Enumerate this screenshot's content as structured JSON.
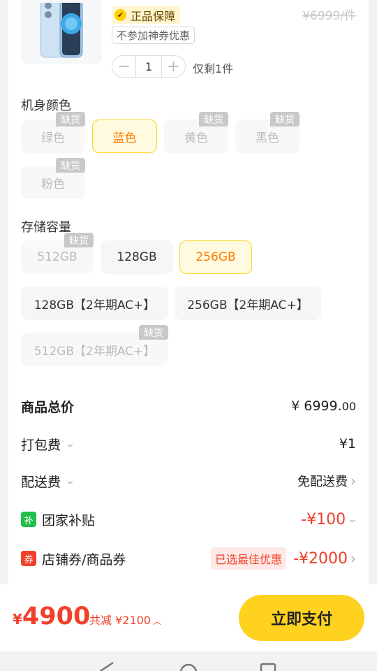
{
  "product": {
    "genuine_badge": "正品保障",
    "no_coupon_badge": "不参加神券优惠",
    "original_price": "¥6999/件",
    "quantity": "1",
    "stock_note": "仅剩1件",
    "image_icon": "phone-image"
  },
  "color_section": {
    "title": "机身颜色",
    "out_of_stock_tag": "缺货",
    "options": [
      {
        "label": "绿色",
        "state": "disabled"
      },
      {
        "label": "蓝色",
        "state": "selected"
      },
      {
        "label": "黄色",
        "state": "disabled"
      },
      {
        "label": "黑色",
        "state": "disabled"
      },
      {
        "label": "粉色",
        "state": "disabled"
      }
    ]
  },
  "storage_section": {
    "title": "存储容量",
    "out_of_stock_tag": "缺货",
    "options": [
      {
        "label": "512GB",
        "state": "disabled"
      },
      {
        "label": "128GB",
        "state": "normal"
      },
      {
        "label": "256GB",
        "state": "selected"
      },
      {
        "label": "128GB【2年期AC+】",
        "state": "normal"
      },
      {
        "label": "256GB【2年期AC+】",
        "state": "normal"
      },
      {
        "label": "512GB【2年期AC+】",
        "state": "disabled"
      }
    ]
  },
  "fees": {
    "total_label": "商品总价",
    "total_value": "¥ 6999.",
    "total_value_decimal": "00",
    "packing_label": "打包费",
    "packing_value": "¥1",
    "delivery_label": "配送费",
    "delivery_value": "免配送费",
    "subsidy_icon_text": "补",
    "subsidy_label": "团家补贴",
    "subsidy_value": "-¥100",
    "coupon_icon_text": "券",
    "coupon_label": "店铺券/商品券",
    "coupon_best": "已选最佳优惠",
    "coupon_value": "-¥2000"
  },
  "checkout": {
    "currency": "¥",
    "total": "4900",
    "saved": "共减 ¥2100",
    "pay_button": "立即支付"
  },
  "colors": {
    "accent_yellow": "#ffd21f",
    "price_red": "#f0402a",
    "selected_text": "#ff7a00",
    "subsidy_green": "#1fbf4a",
    "coupon_red": "#f0402a"
  }
}
